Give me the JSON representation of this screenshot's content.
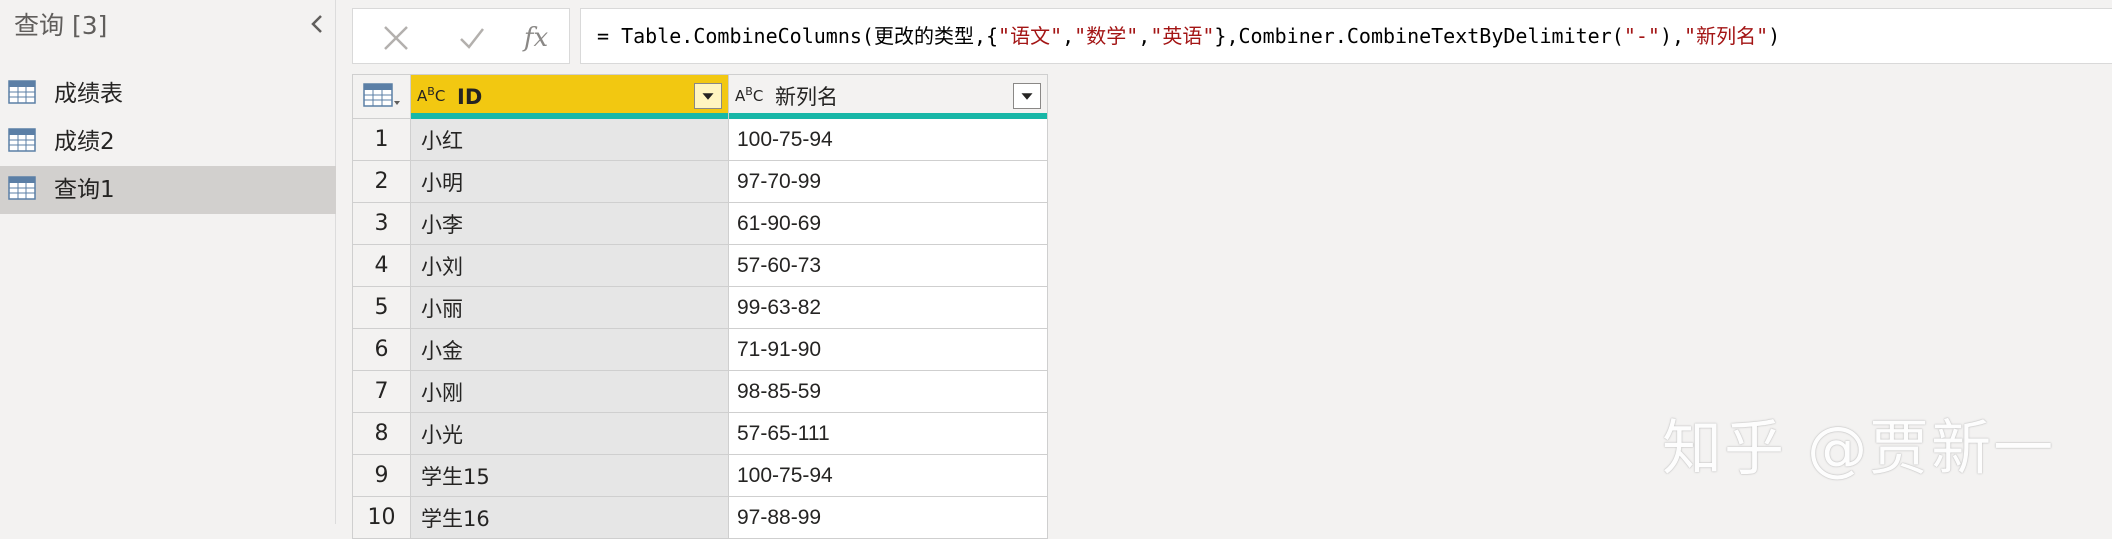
{
  "queries_pane": {
    "title": "查询",
    "count": "[3]",
    "items": [
      {
        "label": "成绩表",
        "selected": false
      },
      {
        "label": "成绩2",
        "selected": false
      },
      {
        "label": "查询1",
        "selected": true
      }
    ]
  },
  "formula_bar": {
    "cancel_icon": "x-icon",
    "commit_icon": "check-icon",
    "fx_label": "fx",
    "parts": {
      "p1": "= Table.CombineColumns(更改的类型,{",
      "s1": "\"语文\"",
      "c1": ",",
      "s2": "\"数学\"",
      "c2": ",",
      "s3": "\"英语\"",
      "p2": "},Combiner.CombineTextByDelimiter(",
      "s4": "\"-\"",
      "p3": "),",
      "s5": "\"新列名\"",
      "p4": ")"
    }
  },
  "grid": {
    "columns": [
      {
        "type": "ABC",
        "label": "ID",
        "selected": true
      },
      {
        "type": "ABC",
        "label": "新列名",
        "selected": false
      }
    ],
    "rows": [
      {
        "n": "1",
        "id": "小红",
        "val": "100-75-94"
      },
      {
        "n": "2",
        "id": "小明",
        "val": "97-70-99"
      },
      {
        "n": "3",
        "id": "小李",
        "val": "61-90-69"
      },
      {
        "n": "4",
        "id": "小刘",
        "val": "57-60-73"
      },
      {
        "n": "5",
        "id": "小丽",
        "val": "99-63-82"
      },
      {
        "n": "6",
        "id": "小金",
        "val": "71-91-90"
      },
      {
        "n": "7",
        "id": "小刚",
        "val": "98-85-59"
      },
      {
        "n": "8",
        "id": "小光",
        "val": "57-65-111"
      },
      {
        "n": "9",
        "id": "学生15",
        "val": "100-75-94"
      },
      {
        "n": "10",
        "id": "学生16",
        "val": "97-88-99"
      }
    ]
  },
  "watermark": "知乎 @贾新一",
  "colors": {
    "selected_header": "#f2c811",
    "quality_bar": "#17b7a7",
    "selected_query": "#d2d0ce",
    "string_literal": "#a31515"
  }
}
